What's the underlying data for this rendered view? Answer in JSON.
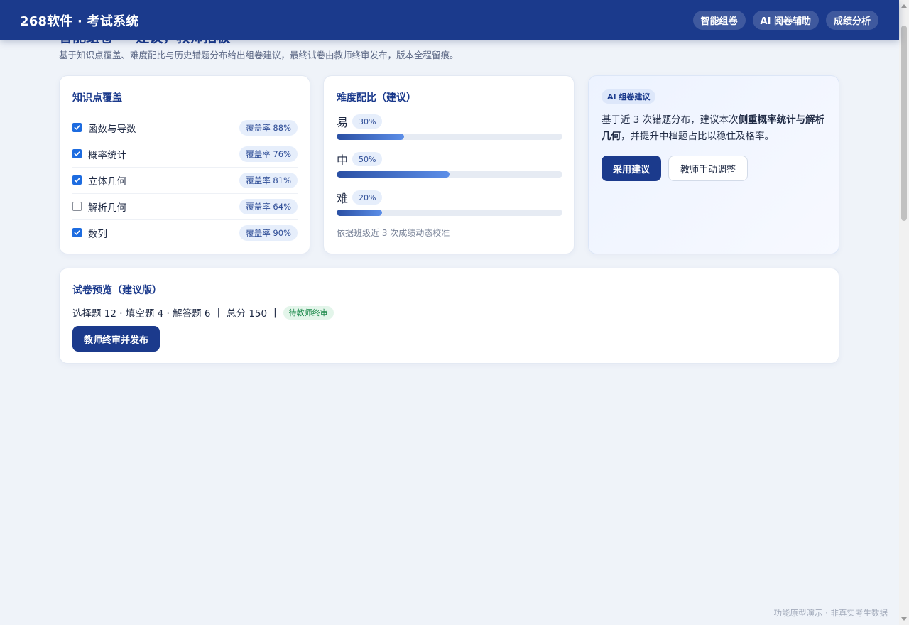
{
  "app": {
    "brand": "268软件 · 考试系统"
  },
  "nav": [
    {
      "label": "智能组卷"
    },
    {
      "label": "AI 阅卷辅助"
    },
    {
      "label": "成绩分析"
    }
  ],
  "hero": {
    "title": "智能组卷 — 建议，教师拍板",
    "subtitle": "基于知识点覆盖、难度配比与历史错题分布给出组卷建议，最终试卷由教师终审发布，版本全程留痕。"
  },
  "knowledge": {
    "title": "知识点覆盖",
    "items": [
      {
        "name": "函数与导数",
        "checked": true,
        "coverage": "覆盖率 88%"
      },
      {
        "name": "概率统计",
        "checked": true,
        "coverage": "覆盖率 76%"
      },
      {
        "name": "立体几何",
        "checked": true,
        "coverage": "覆盖率 81%"
      },
      {
        "name": "解析几何",
        "checked": false,
        "coverage": "覆盖率 64%"
      },
      {
        "name": "数列",
        "checked": true,
        "coverage": "覆盖率 90%"
      }
    ]
  },
  "difficulty": {
    "title": "难度配比（建议）",
    "levels": [
      {
        "level": "易",
        "percent": "30%",
        "value": 0.3
      },
      {
        "level": "中",
        "percent": "50%",
        "value": 0.5
      },
      {
        "level": "难",
        "percent": "20%",
        "value": 0.2
      }
    ],
    "note": "依据班级近 3 次成绩动态校准"
  },
  "ai": {
    "tag": "AI 组卷建议",
    "text_prefix": "基于近 3 次错题分布，建议本次",
    "text_bold": "侧重概率统计与解析几何",
    "text_suffix": "，并提升中档题占比以稳住及格率。",
    "adopt_label": "采用建议",
    "manual_label": "教师手动调整"
  },
  "preview": {
    "title": "试卷预览（建议版）",
    "summary": "选择题 12 · 填空题 4 · 解答题 6",
    "separator": "|",
    "total": "总分 150",
    "status": "待教师终审",
    "publish_label": "教师终审并发布"
  },
  "footer": {
    "note": "功能原型演示 · 非真实考生数据"
  },
  "colors": {
    "brand": "#1b3a8c",
    "accent": "#1d6ce0",
    "status_green": "#1e8a4c",
    "page_bg": "#eff3f9"
  }
}
